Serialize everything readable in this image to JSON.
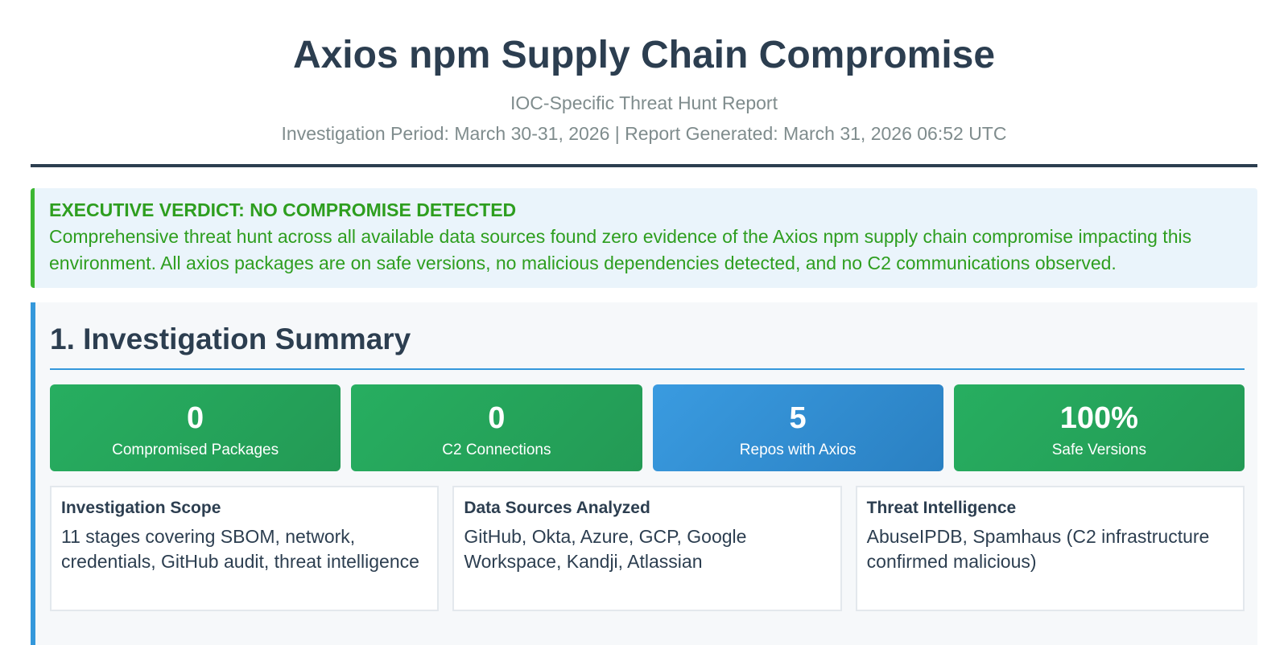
{
  "header": {
    "title": "Axios npm Supply Chain Compromise",
    "subtitle": "IOC-Specific Threat Hunt Report",
    "meta": "Investigation Period: March 30-31, 2026 | Report Generated: March 31, 2026 06:52 UTC"
  },
  "verdict": {
    "heading": "EXECUTIVE VERDICT: NO COMPROMISE DETECTED",
    "body": "Comprehensive threat hunt across all available data sources found zero evidence of the Axios npm supply chain compromise impacting this environment. All axios packages are on safe versions, no malicious dependencies detected, and no C2 communications observed."
  },
  "section": {
    "title": "1. Investigation Summary",
    "stats": [
      {
        "value": "0",
        "label": "Compromised Packages",
        "color": "#27ae60"
      },
      {
        "value": "0",
        "label": "C2 Connections",
        "color": "#27ae60"
      },
      {
        "value": "5",
        "label": "Repos with Axios",
        "color": "#3498db"
      },
      {
        "value": "100%",
        "label": "Safe Versions",
        "color": "#27ae60"
      }
    ],
    "info": [
      {
        "title": "Investigation Scope",
        "body": "11 stages covering SBOM, network, credentials, GitHub audit, threat intelligence"
      },
      {
        "title": "Data Sources Analyzed",
        "body": "GitHub, Okta, Azure, GCP, Google Workspace, Kandji, Atlassian"
      },
      {
        "title": "Threat Intelligence",
        "body": "AbuseIPDB, Spamhaus (C2 infrastructure confirmed malicious)"
      }
    ]
  }
}
